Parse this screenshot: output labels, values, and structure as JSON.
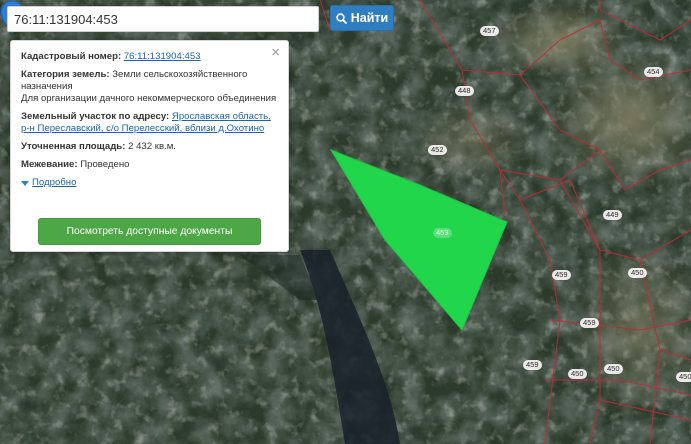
{
  "search": {
    "value": "76:11:131904:453",
    "button_label": "Найти"
  },
  "info": {
    "close_symbol": "×",
    "cadastral_label": "Кадастровый номер:",
    "cadastral_value": "76:11:131904:453",
    "category_label": "Категория земель:",
    "category_value": "Земли сельскохозяйственного назначения",
    "category_use": "Для организации дачного некоммерческого объединения",
    "address_label": "Земельный участок по адресу:",
    "address_value": "Ярославская область, р-н Переславский, с/о Перелесский, вблизи д.Охотино",
    "area_label": "Уточненная площадь:",
    "area_value": "2 432 кв.м.",
    "survey_label": "Межевание:",
    "survey_value": "Проведено",
    "more_label": "Подробно",
    "docs_button": "Посмотреть доступные документы"
  },
  "plots": [
    "457",
    "454",
    "448",
    "452",
    "453",
    "449",
    "459",
    "450",
    "459",
    "450",
    "450",
    "459",
    "450"
  ],
  "colors": {
    "parcel_fill": "#22d64c",
    "boundary": "#c4283a",
    "button_blue": "#2f7ec2",
    "button_green": "#4ea747",
    "link": "#1a64b4",
    "marker": "#2d7fd6"
  },
  "icons": {
    "search": "search-icon",
    "close": "close-icon",
    "marker": "map-marker-icon",
    "expand": "triangle-down-icon"
  }
}
